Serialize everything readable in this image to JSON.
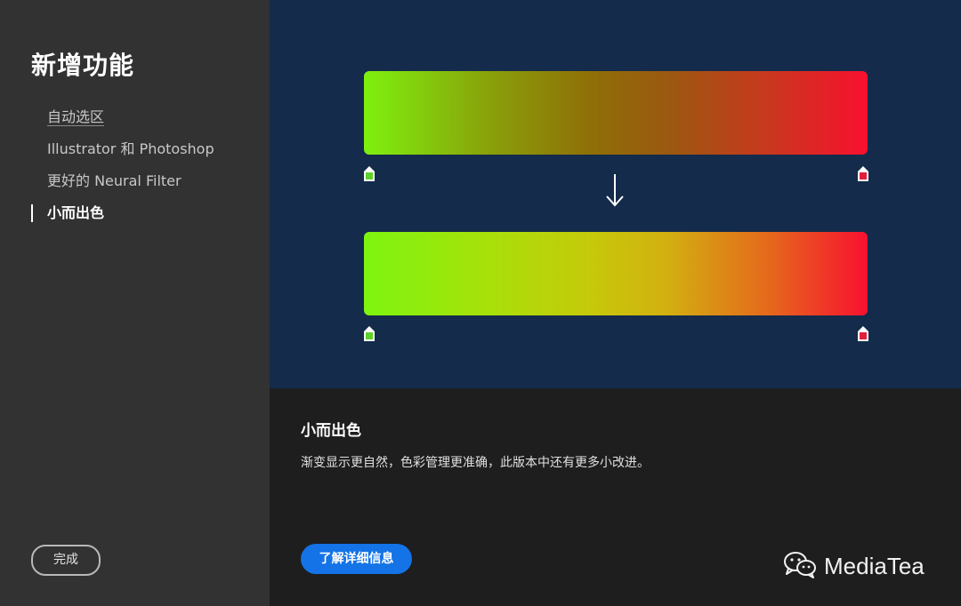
{
  "sidebar": {
    "title": "新增功能",
    "items": [
      {
        "label": "自动选区"
      },
      {
        "label": "Illustrator 和 Photoshop"
      },
      {
        "label": "更好的 Neural Filter"
      },
      {
        "label": "小而出色",
        "active": true
      }
    ],
    "done_label": "完成"
  },
  "preview": {
    "before_gradient": [
      "#7ef10f",
      "#8f6f07",
      "#f8102f"
    ],
    "after_gradient": [
      "#7ef510",
      "#c6c90a",
      "#f8112f"
    ],
    "stop_colors": {
      "left": "#5ed12a",
      "right": "#e0203a"
    },
    "arrow_icon": "arrow-down-icon"
  },
  "info": {
    "heading": "小而出色",
    "description": "渐变显示更自然，色彩管理更准确，此版本中还有更多小改进。",
    "learn_more_label": "了解详细信息"
  },
  "watermark": {
    "icon": "wechat-icon",
    "text": "MediaTea"
  },
  "colors": {
    "sidebar_bg": "#323232",
    "preview_bg": "#142b4b",
    "info_bg": "#1e1e1e",
    "accent": "#1473e6"
  }
}
